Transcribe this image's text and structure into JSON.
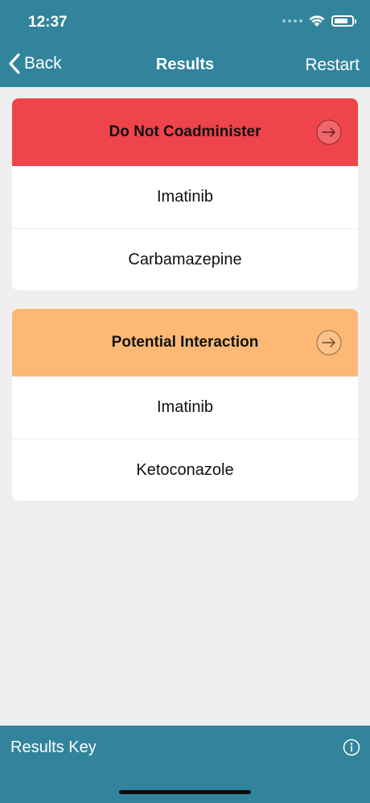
{
  "status_bar": {
    "time": "12:37"
  },
  "nav": {
    "back_label": "Back",
    "title": "Results",
    "restart_label": "Restart"
  },
  "sections": [
    {
      "title": "Do Not Coadminister",
      "color": "#ef444b",
      "icon": "arrow-right-circle-icon",
      "drugs": [
        "Imatinib",
        "Carbamazepine"
      ]
    },
    {
      "title": "Potential Interaction",
      "color": "#fdb876",
      "icon": "arrow-right-circle-icon",
      "drugs": [
        "Imatinib",
        "Ketoconazole"
      ]
    }
  ],
  "footer": {
    "results_key_label": "Results Key",
    "icon": "info-icon"
  },
  "colors": {
    "bar": "#31849c",
    "background": "#efefef"
  }
}
